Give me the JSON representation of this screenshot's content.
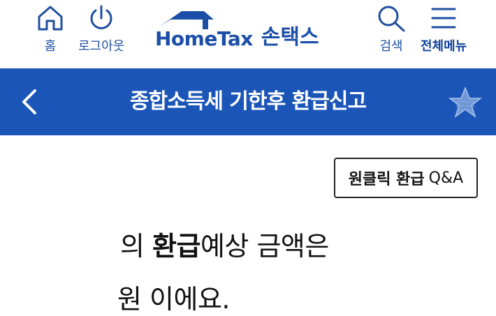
{
  "header": {
    "home_label": "홈",
    "logout_label": "로그아웃",
    "logo_en": "HomeTax",
    "logo_ko": "손택스",
    "search_label": "검색",
    "menu_label": "전체메뉴"
  },
  "titlebar": {
    "title": "종합소득세 기한후 환급신고"
  },
  "content": {
    "qa_button_bold": "원클릭 환급",
    "qa_button_rest": "Q&A",
    "line1_prefix": "의 ",
    "line1_strong": "환급",
    "line1_suffix": "예상 금액은",
    "line2": "원 이에요."
  },
  "colors": {
    "brand_blue": "#1b55b7",
    "logo_blue": "#1b4ea6"
  }
}
